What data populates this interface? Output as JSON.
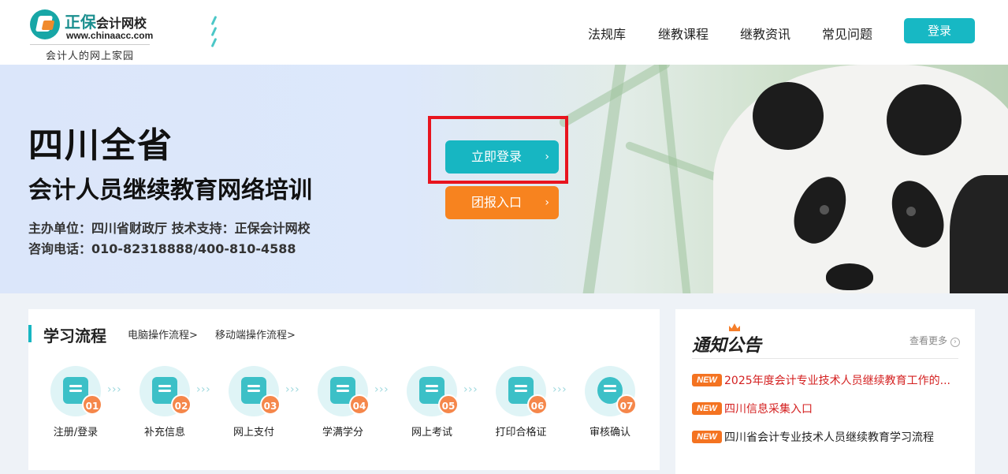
{
  "header": {
    "logo": {
      "brand_big": "正保",
      "brand_small": "会计网校",
      "url": "www.chinaacc.com",
      "tagline": "会计人的网上家园"
    },
    "nav": [
      "法规库",
      "继教课程",
      "继教资讯",
      "常见问题"
    ],
    "login_label": "登录"
  },
  "banner": {
    "title": "四川全省",
    "subtitle": "会计人员继续教育网络培训",
    "host_line": "主办单位：四川省财政厅   技术支持：正保会计网校",
    "phone_line": "咨询电话：010-82318888/400-810-4588",
    "login_cta": "立即登录",
    "group_cta": "团报入口",
    "chevron": "›"
  },
  "process": {
    "title": "学习流程",
    "links": [
      "电脑操作流程>",
      "移动端操作流程>"
    ],
    "arrow": "› › ›",
    "steps": [
      {
        "num": "01",
        "label": "注册/登录",
        "icon": "user-icon"
      },
      {
        "num": "02",
        "label": "补充信息",
        "icon": "form-icon"
      },
      {
        "num": "03",
        "label": "网上支付",
        "icon": "calendar-icon"
      },
      {
        "num": "04",
        "label": "学满学分",
        "icon": "shield-check-icon"
      },
      {
        "num": "05",
        "label": "网上考试",
        "icon": "edit-icon"
      },
      {
        "num": "06",
        "label": "打印合格证",
        "icon": "certificate-icon"
      },
      {
        "num": "07",
        "label": "审核确认",
        "icon": "ring-icon"
      }
    ]
  },
  "notice": {
    "title": "通知公告",
    "more": "查看更多",
    "more_icon": "›",
    "badge": "NEW",
    "items": [
      {
        "text": "2025年度会计专业技术人员继续教育工作的...",
        "color": "#d42020"
      },
      {
        "text": "四川信息采集入口",
        "color": "#d42020"
      },
      {
        "text": "四川省会计专业技术人员继续教育学习流程",
        "color": "#222222"
      }
    ]
  },
  "colors": {
    "accent": "#17b6c2",
    "orange": "#f7831f",
    "highlight": "#e8141e"
  }
}
